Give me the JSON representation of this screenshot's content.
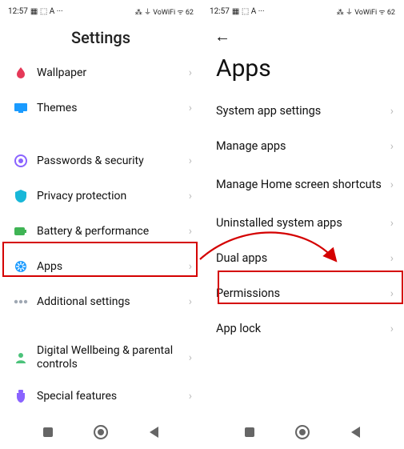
{
  "status": {
    "time": "12:57",
    "icons_left": "▦ ⬚ A ···",
    "icons_right": "⁂ ⏚ VoWiFi ᯤ 62"
  },
  "left": {
    "title": "Settings",
    "items": [
      {
        "icon": "wallpaper",
        "label": "Wallpaper"
      },
      {
        "icon": "themes",
        "label": "Themes"
      },
      {
        "gap": true
      },
      {
        "icon": "security",
        "label": "Passwords & security"
      },
      {
        "icon": "privacy",
        "label": "Privacy protection"
      },
      {
        "icon": "battery",
        "label": "Battery & performance"
      },
      {
        "icon": "apps",
        "label": "Apps",
        "highlight": true
      },
      {
        "icon": "additional",
        "label": "Additional settings"
      },
      {
        "gap": true
      },
      {
        "icon": "wellbeing",
        "label": "Digital Wellbeing & parental controls",
        "tall": true
      },
      {
        "icon": "special",
        "label": "Special features"
      }
    ]
  },
  "right": {
    "title": "Apps",
    "items": [
      {
        "label": "System app settings"
      },
      {
        "label": "Manage apps"
      },
      {
        "label": "Manage Home screen shortcuts",
        "tall": true
      },
      {
        "label": "Uninstalled system apps"
      },
      {
        "label": "Dual apps"
      },
      {
        "label": "Permissions",
        "highlight": true
      },
      {
        "label": "App lock"
      }
    ]
  },
  "nav": {
    "recent": "recent",
    "home": "home",
    "back": "back"
  },
  "colors": {
    "wallpaper": "#e53958",
    "themes": "#1a9bff",
    "security": "#8a63ff",
    "privacy": "#18b7d8",
    "battery": "#3fb455",
    "apps": "#1a9bff",
    "additional": "#9fa8b3",
    "wellbeing": "#4bc27a",
    "special": "#8a63ff"
  }
}
